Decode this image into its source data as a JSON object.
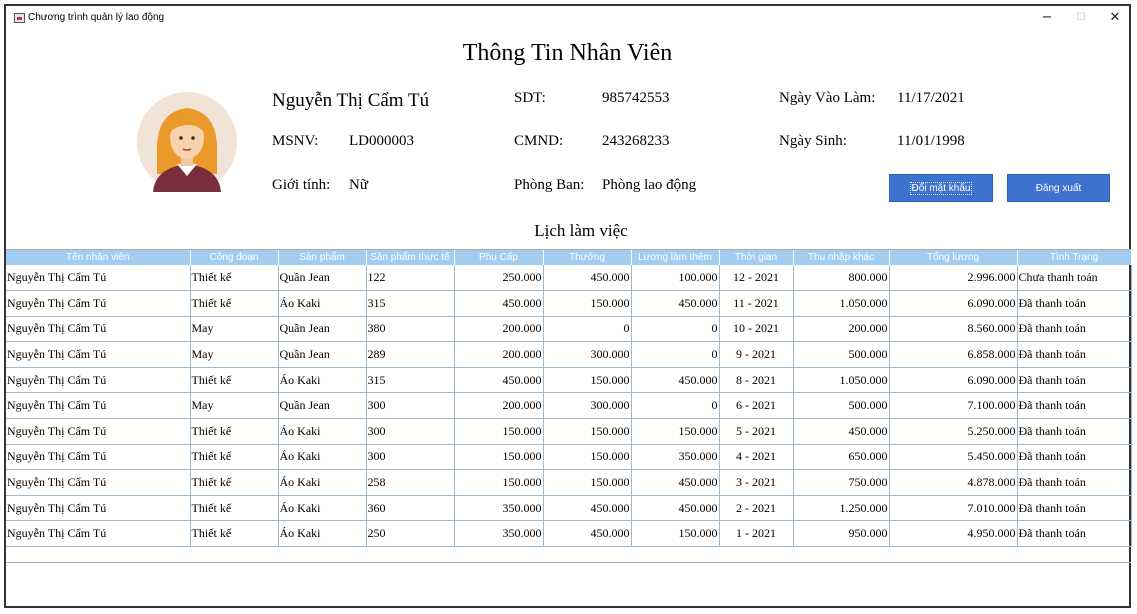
{
  "window": {
    "title": "Chương trình quản lý lao động",
    "minimize": "−",
    "maximize": "☐",
    "close": "✕"
  },
  "page_title": "Thông Tin Nhân Viên",
  "employee": {
    "name": "Nguyễn Thị Cẩm Tú",
    "msnv_label": "MSNV:",
    "msnv": "LD000003",
    "gender_label": "Giới tính:",
    "gender": "Nữ",
    "phone_label": "SDT:",
    "phone": "985742553",
    "id_label": "CMND:",
    "id": "243268233",
    "dept_label": "Phòng Ban:",
    "dept": "Phòng lao động",
    "start_label": "Ngày Vào Làm:",
    "start": "11/17/2021",
    "dob_label": "Ngày Sinh:",
    "dob": "11/01/1998"
  },
  "buttons": {
    "change_password": "Đổi mật khẩu",
    "logout": "Đăng xuất"
  },
  "schedule_title": "Lịch làm việc",
  "table": {
    "headers": [
      "Tên nhân viên",
      "Công đoạn",
      "Sản phẩm",
      "Sản phẩm thực tế",
      "Phụ Cấp",
      "Thưởng",
      "Lương làm thêm",
      "Thời gian",
      "Thu nhập khác",
      "Tổng lương",
      "Tình Trạng"
    ],
    "rows": [
      [
        "Nguyễn Thị Cẩm Tú",
        "Thiết kế",
        "Quần Jean",
        "122",
        "250.000",
        "450.000",
        "100.000",
        "12 - 2021",
        "800.000",
        "2.996.000",
        "Chưa thanh toán"
      ],
      [
        "Nguyễn Thị Cẩm Tú",
        "Thiết kế",
        "Áo Kaki",
        "315",
        "450.000",
        "150.000",
        "450.000",
        "11 - 2021",
        "1.050.000",
        "6.090.000",
        "Đã thanh toán"
      ],
      [
        "Nguyễn Thị Cẩm Tú",
        "May",
        "Quần Jean",
        "380",
        "200.000",
        "0",
        "0",
        "10 - 2021",
        "200.000",
        "8.560.000",
        "Đã thanh toán"
      ],
      [
        "Nguyễn Thị Cẩm Tú",
        "May",
        "Quần Jean",
        "289",
        "200.000",
        "300.000",
        "0",
        "9 - 2021",
        "500.000",
        "6.858.000",
        "Đã thanh toán"
      ],
      [
        "Nguyễn Thị Cẩm Tú",
        "Thiết kế",
        "Áo Kaki",
        "315",
        "450.000",
        "150.000",
        "450.000",
        "8 - 2021",
        "1.050.000",
        "6.090.000",
        "Đã thanh toán"
      ],
      [
        "Nguyễn Thị Cẩm Tú",
        "May",
        "Quần Jean",
        "300",
        "200.000",
        "300.000",
        "0",
        "6 - 2021",
        "500.000",
        "7.100.000",
        "Đã thanh toán"
      ],
      [
        "Nguyễn Thị Cẩm Tú",
        "Thiết kế",
        "Áo Kaki",
        "300",
        "150.000",
        "150.000",
        "150.000",
        "5 - 2021",
        "450.000",
        "5.250.000",
        "Đã thanh toán"
      ],
      [
        "Nguyễn Thị Cẩm Tú",
        "Thiết kế",
        "Áo Kaki",
        "300",
        "150.000",
        "150.000",
        "350.000",
        "4 - 2021",
        "650.000",
        "5.450.000",
        "Đã thanh toán"
      ],
      [
        "Nguyễn Thị Cẩm Tú",
        "Thiết kế",
        "Áo Kaki",
        "258",
        "150.000",
        "150.000",
        "450.000",
        "3 - 2021",
        "750.000",
        "4.878.000",
        "Đã thanh toán"
      ],
      [
        "Nguyễn Thị Cẩm Tú",
        "Thiết kế",
        "Áo Kaki",
        "360",
        "350.000",
        "450.000",
        "450.000",
        "2 - 2021",
        "1.250.000",
        "7.010.000",
        "Đã thanh toán"
      ],
      [
        "Nguyễn Thị Cẩm Tú",
        "Thiết kế",
        "Áo Kaki",
        "250",
        "350.000",
        "450.000",
        "150.000",
        "1 - 2021",
        "950.000",
        "4.950.000",
        "Đã thanh toán"
      ]
    ]
  }
}
